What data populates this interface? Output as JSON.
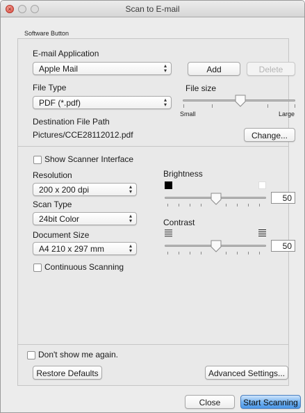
{
  "window": {
    "title": "Scan to E-mail",
    "close_glyph": "×"
  },
  "group_label": "Software Button",
  "email": {
    "application_label": "E-mail Application",
    "application_value": "Apple Mail",
    "add_label": "Add",
    "delete_label": "Delete"
  },
  "file_type": {
    "label": "File Type",
    "value": "PDF (*.pdf)"
  },
  "file_size": {
    "label": "File size",
    "small_label": "Small",
    "large_label": "Large",
    "level": 0.5
  },
  "destination": {
    "label": "Destination File Path",
    "path": "Pictures/CCE28112012.pdf",
    "change_label": "Change..."
  },
  "scanner": {
    "show_interface_label": "Show Scanner Interface",
    "resolution_label": "Resolution",
    "resolution_value": "200 x 200 dpi",
    "scan_type_label": "Scan Type",
    "scan_type_value": "24bit Color",
    "document_size_label": "Document Size",
    "document_size_value": "A4 210 x 297 mm",
    "continuous_label": "Continuous Scanning"
  },
  "brightness": {
    "label": "Brightness",
    "value": "50",
    "level": 0.5
  },
  "contrast": {
    "label": "Contrast",
    "value": "50",
    "level": 0.5
  },
  "footer": {
    "dont_show_label": "Don't show me again.",
    "restore_label": "Restore Defaults",
    "advanced_label": "Advanced Settings...",
    "close_label": "Close",
    "start_label": "Start Scanning"
  },
  "icons": {
    "updown": "▴▾",
    "slider_thumb": "slider-thumb-icon"
  },
  "colors": {
    "primary_button": "#4c97e7",
    "window_bg": "#ececec",
    "close_light": "#d9463a"
  }
}
